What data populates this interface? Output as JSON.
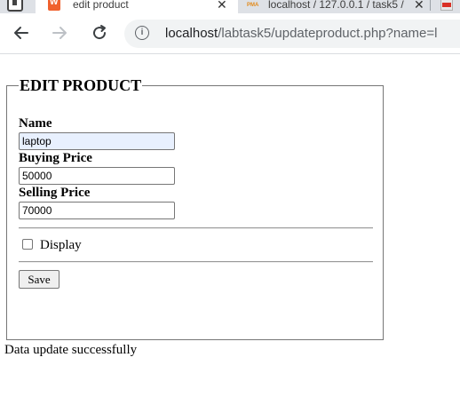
{
  "browser": {
    "tabs": [
      {
        "title": "edit product",
        "active": true
      },
      {
        "title": "localhost / 127.0.0.1 / task5 /",
        "active": false
      }
    ],
    "address_bar": {
      "host": "localhost",
      "path": "/labtask5/updateproduct.php?name=l"
    }
  },
  "form": {
    "legend": "EDIT PRODUCT",
    "name_label": "Name",
    "name_value": "laptop",
    "buying_price_label": "Buying Price",
    "buying_price_value": "50000",
    "selling_price_label": "Selling Price",
    "selling_price_value": "70000",
    "display_label": "Display",
    "display_checked": false,
    "save_label": "Save"
  },
  "status_message": "Data update successfully"
}
